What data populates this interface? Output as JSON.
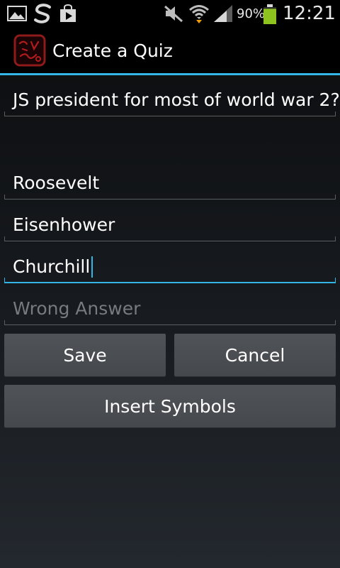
{
  "status_bar": {
    "battery_percent": "90%",
    "time": "12:21",
    "icons": [
      "gallery-icon",
      "sync-icon",
      "play-store-icon",
      "mute-icon",
      "wifi-icon",
      "signal-icon",
      "battery-icon"
    ],
    "battery_color": "#8dc21f",
    "battery_level": 0.9
  },
  "action_bar": {
    "title": "Create a Quiz",
    "accent_color": "#33b5e5"
  },
  "form": {
    "question": "JS president for most of world war 2?",
    "answers": [
      "Roosevelt",
      "Eisenhower",
      "Churchill"
    ],
    "wrong_answer_placeholder": "Wrong Answer"
  },
  "buttons": {
    "save": "Save",
    "cancel": "Cancel",
    "insert_symbols": "Insert Symbols"
  }
}
